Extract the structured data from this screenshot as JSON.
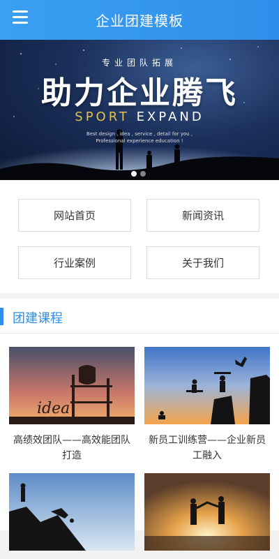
{
  "header": {
    "title": "企业团建模板",
    "menu_icon": "menu-icon"
  },
  "banner": {
    "top_text": "专业团队拓展",
    "main_text": "助力企业腾飞",
    "sub_word1": "SPORT",
    "sub_word2": "EXPAND",
    "desc": "Best design , idea , service , detail for you , Professional experience education !",
    "slide_count": 2,
    "active_slide": 1
  },
  "nav": {
    "items": [
      {
        "label": "网站首页"
      },
      {
        "label": "新闻资讯"
      },
      {
        "label": "行业案例"
      },
      {
        "label": "关于我们"
      }
    ]
  },
  "section": {
    "title": "团建课程",
    "accent_color": "#2f8ee9",
    "cards": [
      {
        "title": "高绩效团队——高效能团队打造"
      },
      {
        "title": "新员工训练营——企业新员工融入"
      },
      {
        "title": ""
      },
      {
        "title": ""
      }
    ]
  }
}
